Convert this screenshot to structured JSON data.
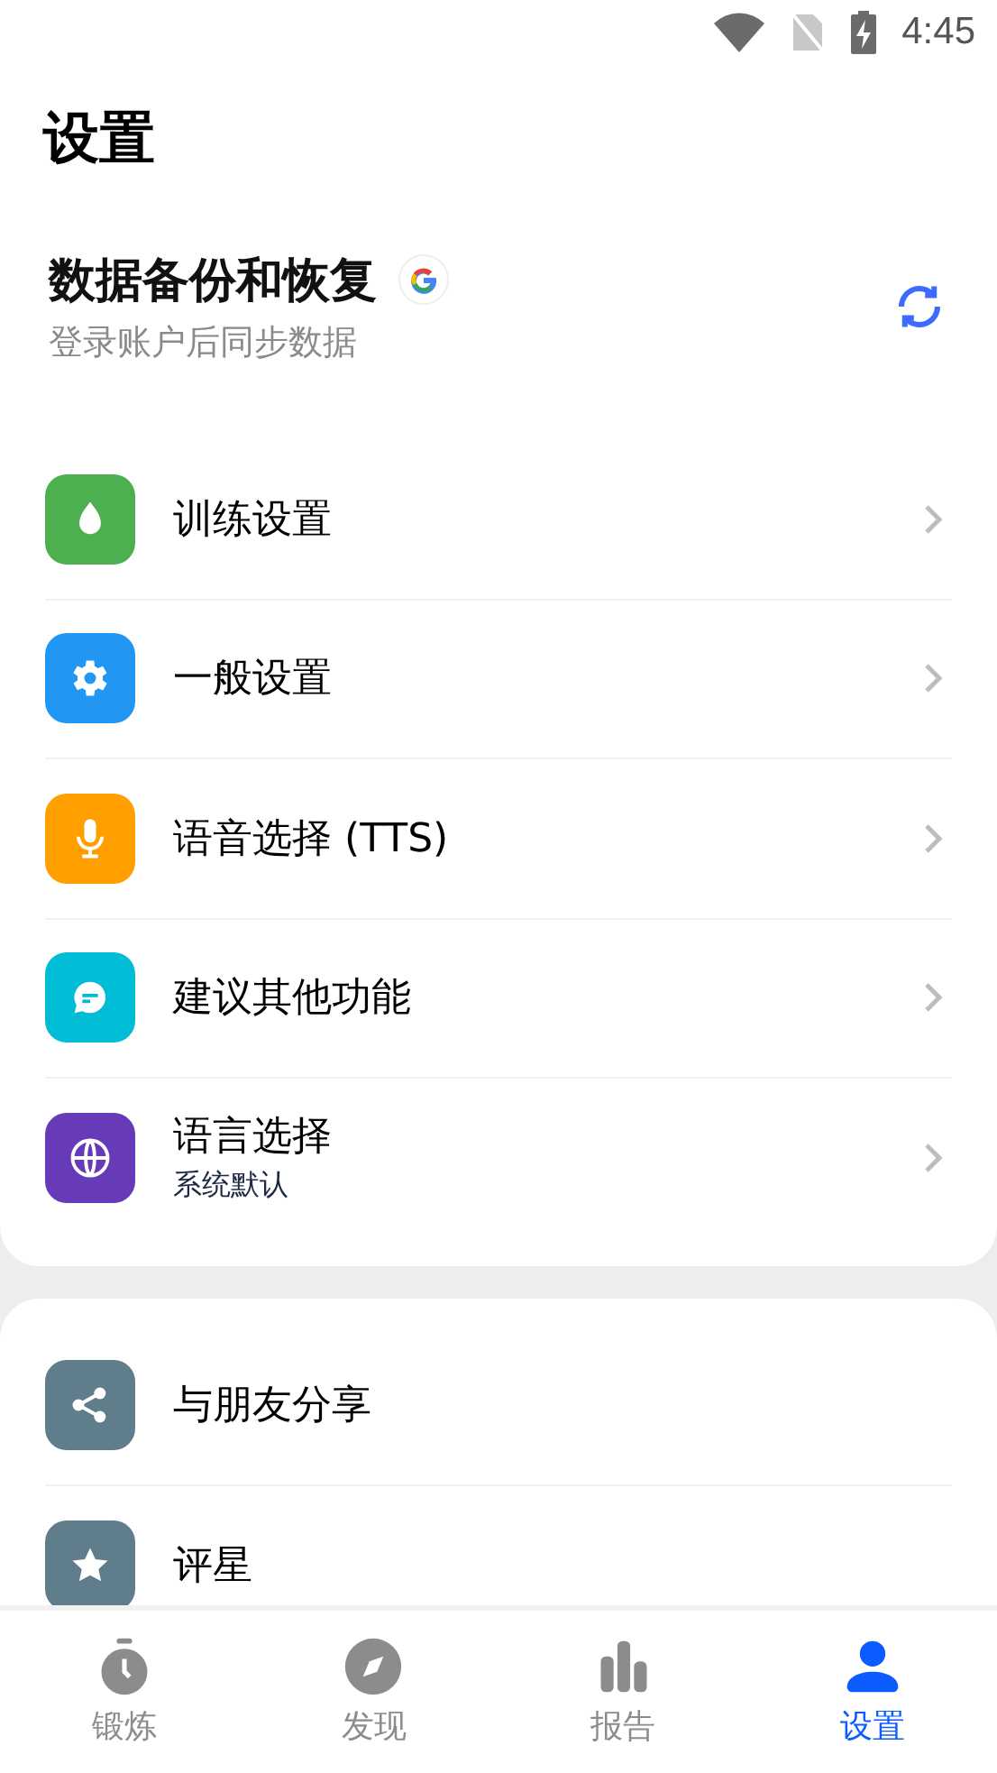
{
  "status_bar": {
    "time": "4:45"
  },
  "title": "设置",
  "backup": {
    "title": "数据备份和恢复",
    "subtitle": "登录账户后同步数据"
  },
  "settings": [
    {
      "label": "训练设置",
      "color": "#4caf50",
      "chevron": true
    },
    {
      "label": "一般设置",
      "color": "#2196f3",
      "chevron": true
    },
    {
      "label": "语音选择 (TTS)",
      "color": "#ffa000",
      "chevron": true
    },
    {
      "label": "建议其他功能",
      "color": "#00bcd4",
      "chevron": true
    },
    {
      "label": "语言选择",
      "subtitle": "系统默认",
      "color": "#673ab7",
      "chevron": true
    }
  ],
  "more": [
    {
      "label": "与朋友分享",
      "color": "#607d8b",
      "chevron": false
    },
    {
      "label": "评星",
      "color": "#607d8b",
      "chevron": false
    }
  ],
  "tabs": [
    {
      "label": "锻炼",
      "selected": false
    },
    {
      "label": "发现",
      "selected": false
    },
    {
      "label": "报告",
      "selected": false
    },
    {
      "label": "设置",
      "selected": true
    }
  ]
}
